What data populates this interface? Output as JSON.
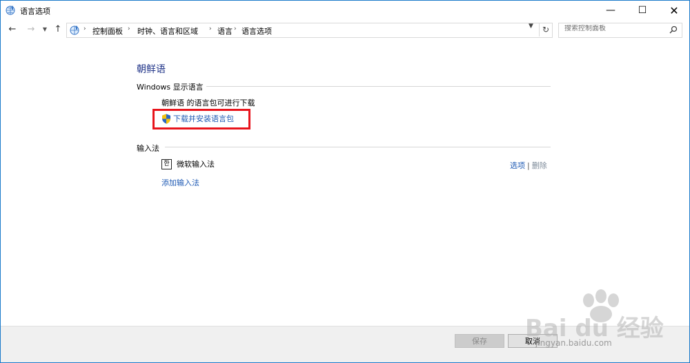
{
  "window": {
    "title": "语言选项"
  },
  "address": {
    "crumbs": [
      "控制面板",
      "时钟、语言和区域",
      "语言",
      "语言选项"
    ]
  },
  "search": {
    "placeholder": "搜索控制面板"
  },
  "language": {
    "name": "朝鲜语",
    "display_section": "Windows 显示语言",
    "pack_available": "朝鲜语 的语言包可进行下载",
    "download_link": "下载并安装语言包"
  },
  "ime": {
    "section": "输入法",
    "icon_glyph": "한",
    "name": "微软输入法",
    "options_label": "选项",
    "separator": "|",
    "delete_label": "删除",
    "add_label": "添加输入法"
  },
  "footer": {
    "save_label": "保存",
    "cancel_label": "取消"
  },
  "watermark": {
    "brand": "Bai du 经验",
    "url": "jingyan.baidu.com"
  },
  "colors": {
    "link": "#1e5ab4",
    "title": "#1e3287",
    "highlight": "#e8141c",
    "border": "#1979ca"
  },
  "icons": {
    "app": "globe-language-icon",
    "back": "arrow-left-icon",
    "forward": "arrow-right-icon",
    "up": "arrow-up-icon",
    "refresh": "refresh-icon",
    "search": "search-icon",
    "shield": "uac-shield-icon"
  }
}
